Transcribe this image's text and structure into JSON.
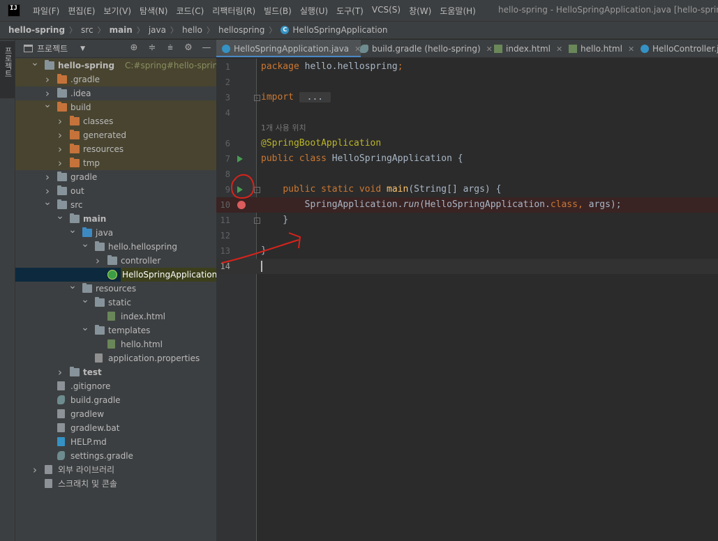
{
  "menubar": {
    "logo": "IJ",
    "items": [
      "파일(F)",
      "편집(E)",
      "보기(V)",
      "탐색(N)",
      "코드(C)",
      "리팩터링(R)",
      "빌드(B)",
      "실행(U)",
      "도구(T)",
      "VCS(S)",
      "창(W)",
      "도움말(H)"
    ],
    "window_title": "hello-spring - HelloSpringApplication.java [hello-spring.ma"
  },
  "breadcrumb": {
    "items": [
      "hello-spring",
      "src",
      "main",
      "java",
      "hello",
      "hellospring",
      "HelloSpringApplication"
    ]
  },
  "toolstrip": {
    "label": "프로젝트"
  },
  "project_panel": {
    "title": "프로젝트",
    "tools": [
      "locate-icon",
      "expand-all-icon",
      "collapse-all-icon",
      "gear-icon",
      "hide-icon"
    ],
    "tree": [
      {
        "label": "hello-spring",
        "path": "C:#spring#hello-spring",
        "icon": "module-folder",
        "depth": 0,
        "arrow": "down",
        "bold": true,
        "state": "highlight"
      },
      {
        "label": ".gradle",
        "icon": "folder-orange",
        "depth": 1,
        "arrow": "right",
        "state": "highlight"
      },
      {
        "label": ".idea",
        "icon": "folder-gray",
        "depth": 1,
        "arrow": "right",
        "state": ""
      },
      {
        "label": "build",
        "icon": "folder-orange",
        "depth": 1,
        "arrow": "down",
        "state": "highlight"
      },
      {
        "label": "classes",
        "icon": "folder-orange",
        "depth": 2,
        "arrow": "right",
        "state": "highlight"
      },
      {
        "label": "generated",
        "icon": "folder-orange",
        "depth": 2,
        "arrow": "right",
        "state": "highlight"
      },
      {
        "label": "resources",
        "icon": "folder-orange",
        "depth": 2,
        "arrow": "right",
        "state": "highlight"
      },
      {
        "label": "tmp",
        "icon": "folder-orange",
        "depth": 2,
        "arrow": "right",
        "state": "highlight"
      },
      {
        "label": "gradle",
        "icon": "folder-gray",
        "depth": 1,
        "arrow": "right",
        "state": ""
      },
      {
        "label": "out",
        "icon": "folder-gray",
        "depth": 1,
        "arrow": "right",
        "state": ""
      },
      {
        "label": "src",
        "icon": "folder-gray",
        "depth": 1,
        "arrow": "down",
        "state": ""
      },
      {
        "label": "main",
        "icon": "folder-gray",
        "depth": 2,
        "arrow": "down",
        "bold": true,
        "state": ""
      },
      {
        "label": "java",
        "icon": "folder-blue",
        "depth": 3,
        "arrow": "down",
        "state": ""
      },
      {
        "label": "hello.hellospring",
        "icon": "package",
        "depth": 4,
        "arrow": "down",
        "state": ""
      },
      {
        "label": "controller",
        "icon": "package",
        "depth": 5,
        "arrow": "right",
        "state": ""
      },
      {
        "label": "HelloSpringApplication",
        "icon": "spring-class",
        "depth": 5,
        "arrow": "",
        "state": "selected"
      },
      {
        "label": "resources",
        "icon": "folder-res",
        "depth": 3,
        "arrow": "down",
        "state": ""
      },
      {
        "label": "static",
        "icon": "folder-gray",
        "depth": 4,
        "arrow": "down",
        "state": ""
      },
      {
        "label": "index.html",
        "icon": "file-html",
        "depth": 5,
        "arrow": "",
        "state": ""
      },
      {
        "label": "templates",
        "icon": "folder-gray",
        "depth": 4,
        "arrow": "down",
        "state": ""
      },
      {
        "label": "hello.html",
        "icon": "file-html",
        "depth": 5,
        "arrow": "",
        "state": ""
      },
      {
        "label": "application.properties",
        "icon": "file-props",
        "depth": 4,
        "arrow": "",
        "state": ""
      },
      {
        "label": "test",
        "icon": "folder-gray",
        "depth": 2,
        "arrow": "right",
        "bold": true,
        "state": ""
      },
      {
        "label": ".gitignore",
        "icon": "file-plain",
        "depth": 1,
        "arrow": "",
        "state": ""
      },
      {
        "label": "build.gradle",
        "icon": "file-gradle",
        "depth": 1,
        "arrow": "",
        "state": ""
      },
      {
        "label": "gradlew",
        "icon": "file-plain",
        "depth": 1,
        "arrow": "",
        "state": ""
      },
      {
        "label": "gradlew.bat",
        "icon": "file-plain",
        "depth": 1,
        "arrow": "",
        "state": ""
      },
      {
        "label": "HELP.md",
        "icon": "file-md",
        "depth": 1,
        "arrow": "",
        "state": ""
      },
      {
        "label": "settings.gradle",
        "icon": "file-gradle",
        "depth": 1,
        "arrow": "",
        "state": ""
      },
      {
        "label": "외부 라이브러리",
        "icon": "library",
        "depth": 0,
        "arrow": "right",
        "state": ""
      },
      {
        "label": "스크래치 및 콘솔",
        "icon": "scratch",
        "depth": 0,
        "arrow": "",
        "state": ""
      }
    ]
  },
  "tabs": [
    {
      "label": "HelloSpringApplication.java",
      "icon": "c",
      "active": true,
      "closable": true
    },
    {
      "label": "build.gradle (hello-spring)",
      "icon": "g",
      "active": false,
      "closable": true
    },
    {
      "label": "index.html",
      "icon": "h",
      "active": false,
      "closable": true
    },
    {
      "label": "hello.html",
      "icon": "h",
      "active": false,
      "closable": true
    },
    {
      "label": "HelloController.ja",
      "icon": "c",
      "active": false,
      "closable": false
    }
  ],
  "editor": {
    "usage_hint": "1개 사용 위치",
    "lines": [
      {
        "num": "1",
        "tokens": [
          [
            "kw",
            "package "
          ],
          [
            "plain",
            "hello.hellospring"
          ],
          [
            "kw",
            ";"
          ]
        ]
      },
      {
        "num": "2",
        "tokens": []
      },
      {
        "num": "3",
        "tokens": [
          [
            "kw",
            "import "
          ],
          [
            "fold",
            " ... "
          ]
        ],
        "fold": true
      },
      {
        "num": "4",
        "tokens": []
      },
      {
        "num": "",
        "hint": true
      },
      {
        "num": "6",
        "tokens": [
          [
            "ann",
            "@SpringBootApplication"
          ]
        ]
      },
      {
        "num": "7",
        "tokens": [
          [
            "kw",
            "public class "
          ],
          [
            "plain",
            "HelloSpringApplication {"
          ]
        ],
        "run": true
      },
      {
        "num": "8",
        "tokens": []
      },
      {
        "num": "9",
        "tokens": [
          [
            "plain",
            "    "
          ],
          [
            "kw",
            "public static void "
          ],
          [
            "fn",
            "main"
          ],
          [
            "plain",
            "(String[] args) {"
          ]
        ],
        "run": true,
        "fold": true
      },
      {
        "num": "10",
        "tokens": [
          [
            "plain",
            "        SpringApplication."
          ],
          [
            "it",
            "run"
          ],
          [
            "plain",
            "(HelloSpringApplication."
          ],
          [
            "kw",
            "class"
          ],
          [
            "kw",
            ", "
          ],
          [
            "plain",
            "args);"
          ]
        ],
        "breakpoint": true
      },
      {
        "num": "11",
        "tokens": [
          [
            "plain",
            "    }"
          ]
        ],
        "fold": true
      },
      {
        "num": "12",
        "tokens": []
      },
      {
        "num": "13",
        "tokens": [
          [
            "plain",
            "}"
          ]
        ]
      },
      {
        "num": "14",
        "tokens": [],
        "current": true
      }
    ]
  },
  "colors": {
    "keyword": "#cc7832",
    "annotation": "#bbb529",
    "function": "#ffc66d",
    "plain": "#a9b7c6",
    "annotation_mark": "#d8231b"
  }
}
